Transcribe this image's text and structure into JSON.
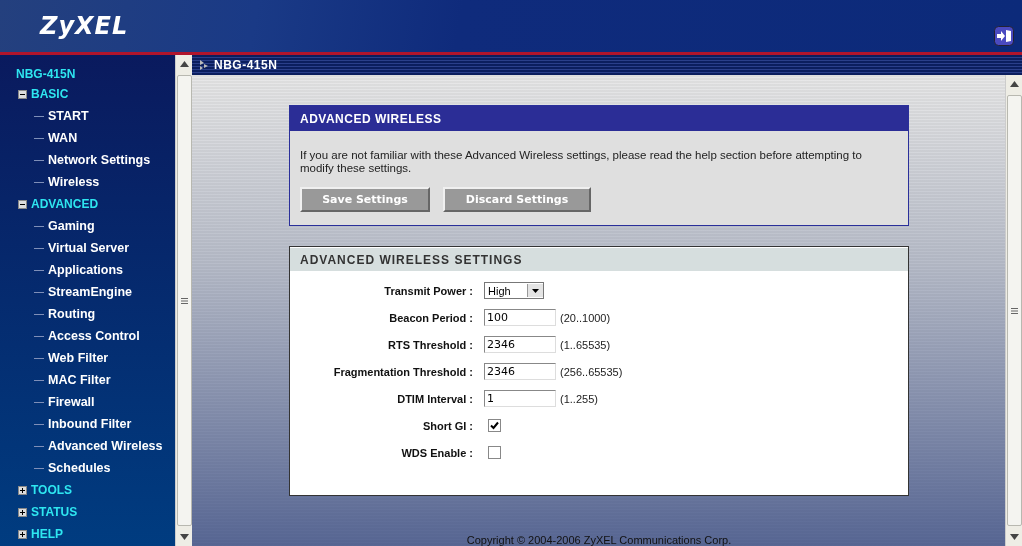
{
  "header": {
    "logo": "ZyXEL"
  },
  "sidebar": {
    "root": "NBG-415N",
    "groups": [
      {
        "label": "BASIC",
        "expanded": true,
        "children": [
          {
            "label": "START"
          },
          {
            "label": "WAN"
          },
          {
            "label": "Network Settings"
          },
          {
            "label": "Wireless"
          }
        ]
      },
      {
        "label": "ADVANCED",
        "expanded": true,
        "children": [
          {
            "label": "Gaming"
          },
          {
            "label": "Virtual Server"
          },
          {
            "label": "Applications"
          },
          {
            "label": "StreamEngine"
          },
          {
            "label": "Routing"
          },
          {
            "label": "Access Control"
          },
          {
            "label": "Web Filter"
          },
          {
            "label": "MAC Filter"
          },
          {
            "label": "Firewall"
          },
          {
            "label": "Inbound Filter"
          },
          {
            "label": "Advanced Wireless"
          },
          {
            "label": "Schedules"
          }
        ]
      },
      {
        "label": "TOOLS",
        "expanded": false
      },
      {
        "label": "STATUS",
        "expanded": false
      },
      {
        "label": "HELP",
        "expanded": false
      }
    ]
  },
  "breadcrumb": "NBG-415N",
  "intro_panel": {
    "title": "ADVANCED WIRELESS",
    "text": "If you are not familiar with these Advanced Wireless settings, please read the help section before attempting to modify these settings.",
    "buttons": [
      "Save Settings",
      "Discard Settings"
    ]
  },
  "settings_panel": {
    "title": "ADVANCED WIRELESS SETTINGS",
    "fields": [
      {
        "kind": "select",
        "label": "Transmit Power :",
        "value": "High"
      },
      {
        "kind": "text",
        "label": "Beacon Period :",
        "value": "100",
        "hint": "(20..1000)"
      },
      {
        "kind": "text",
        "label": "RTS Threshold :",
        "value": "2346",
        "hint": "(1..65535)"
      },
      {
        "kind": "text",
        "label": "Fragmentation Threshold :",
        "value": "2346",
        "hint": "(256..65535)"
      },
      {
        "kind": "text",
        "label": "DTIM Interval :",
        "value": "1",
        "hint": "(1..255)"
      },
      {
        "kind": "checkbox",
        "label": "Short GI :",
        "checked": true
      },
      {
        "kind": "checkbox",
        "label": "WDS Enable :",
        "checked": false
      }
    ]
  },
  "footer": "Copyright © 2004-2006 ZyXEL Communications Corp."
}
